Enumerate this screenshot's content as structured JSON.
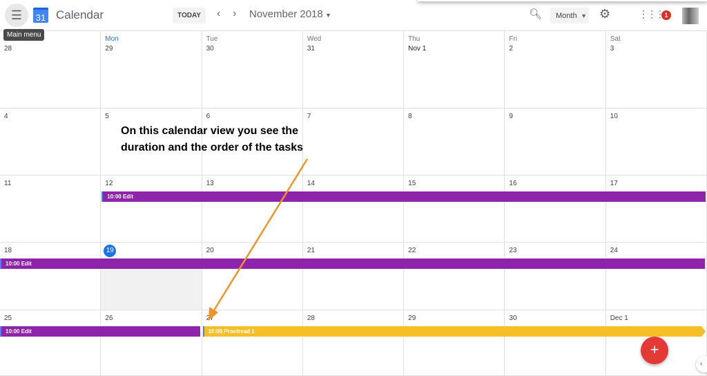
{
  "header": {
    "menu_tooltip": "Main menu",
    "logo_day": "31",
    "app_name": "Calendar",
    "today": "TODAY",
    "prev": "‹",
    "next": "›",
    "current_period": "November 2018",
    "view": "Month",
    "notifications": "1"
  },
  "weekdays": [
    "Sun",
    "Mon",
    "Tue",
    "Wed",
    "Thu",
    "Fri",
    "Sat"
  ],
  "weeks": [
    [
      "28",
      "29",
      "30",
      "31",
      "Nov 1",
      "2",
      "3"
    ],
    [
      "4",
      "5",
      "6",
      "7",
      "8",
      "9",
      "10"
    ],
    [
      "11",
      "12",
      "13",
      "14",
      "15",
      "16",
      "17"
    ],
    [
      "18",
      "19",
      "20",
      "21",
      "22",
      "23",
      "24"
    ],
    [
      "25",
      "26",
      "27",
      "28",
      "29",
      "30",
      "Dec 1"
    ]
  ],
  "today_date": "19",
  "events": [
    {
      "label": "10:00 Edit",
      "week": 2,
      "start": 1,
      "end": 6,
      "color": "#8e24aa"
    },
    {
      "label": "10:00 Edit",
      "week": 3,
      "start": 0,
      "end": 6,
      "color": "#8e24aa"
    },
    {
      "label": "10:00 Edit",
      "week": 4,
      "start": 0,
      "end": 1,
      "color": "#8e24aa"
    },
    {
      "label": "10:00 Proofread 1",
      "week": 4,
      "start": 2,
      "end": 6,
      "color": "#f6bf26",
      "continues": true
    }
  ],
  "annotation": {
    "line1": "On this calendar view you see the",
    "line2": "duration and the order of the tasks",
    "color": "#f39325"
  },
  "fab": "+",
  "colors": {
    "accent": "#1a73e8",
    "edit": "#8e24aa",
    "proofread": "#f6bf26"
  }
}
